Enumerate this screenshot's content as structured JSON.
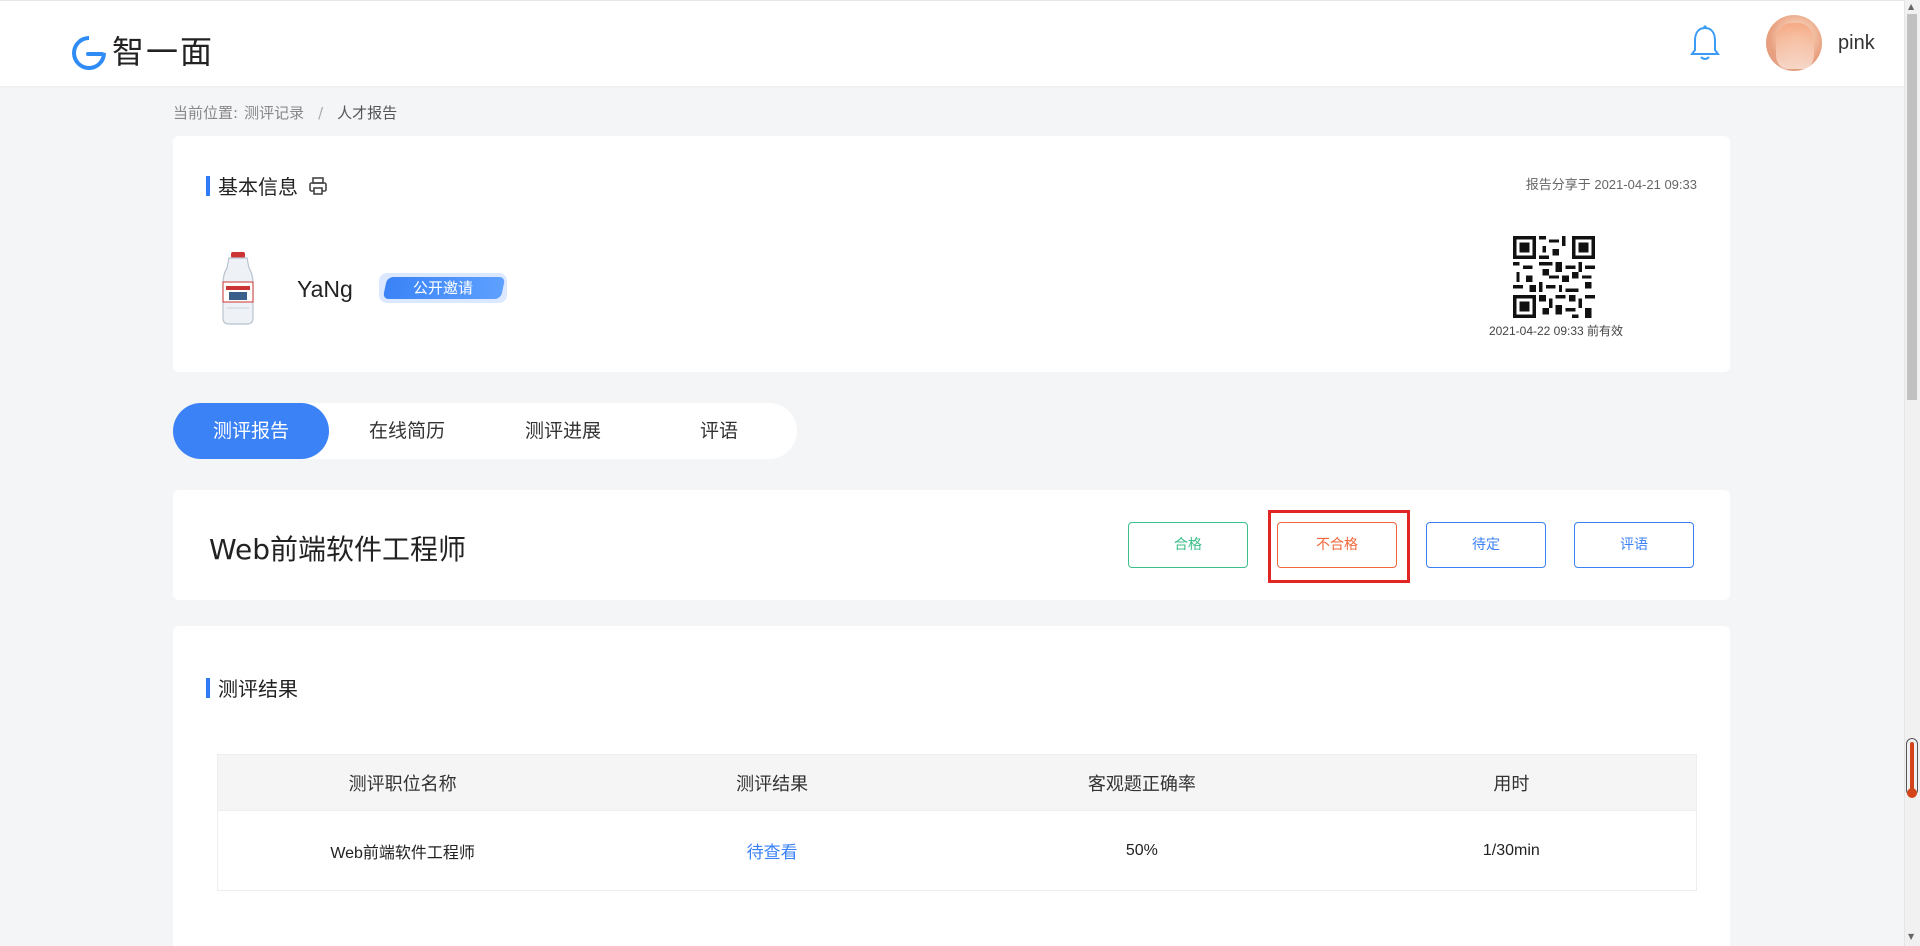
{
  "header": {
    "logo_text": "智一面",
    "username": "pink"
  },
  "breadcrumb": {
    "prefix": "当前位置:",
    "items": [
      "测评记录",
      "人才报告"
    ],
    "separator": "/"
  },
  "basic_info": {
    "title": "基本信息",
    "share_text": "报告分享于 2021-04-21 09:33",
    "candidate_name": "YaNg",
    "invite_badge": "公开邀请",
    "qr_caption": "2021-04-22 09:33 前有效"
  },
  "tabs": [
    {
      "label": "测评报告",
      "active": true
    },
    {
      "label": "在线简历",
      "active": false
    },
    {
      "label": "测评进展",
      "active": false
    },
    {
      "label": "评语",
      "active": false
    }
  ],
  "job": {
    "title": "Web前端软件工程师",
    "actions": {
      "pass": "合格",
      "fail": "不合格",
      "pending": "待定",
      "comment": "评语"
    }
  },
  "result": {
    "title": "测评结果",
    "columns": [
      "测评职位名称",
      "测评结果",
      "客观题正确率",
      "用时"
    ],
    "rows": [
      {
        "position": "Web前端软件工程师",
        "result": "待查看",
        "accuracy": "50%",
        "time": "1/30min"
      }
    ]
  },
  "colors": {
    "primary": "#3b82f6",
    "pass": "#3cbf8a",
    "fail": "#f0673a",
    "highlight": "#e02525"
  }
}
